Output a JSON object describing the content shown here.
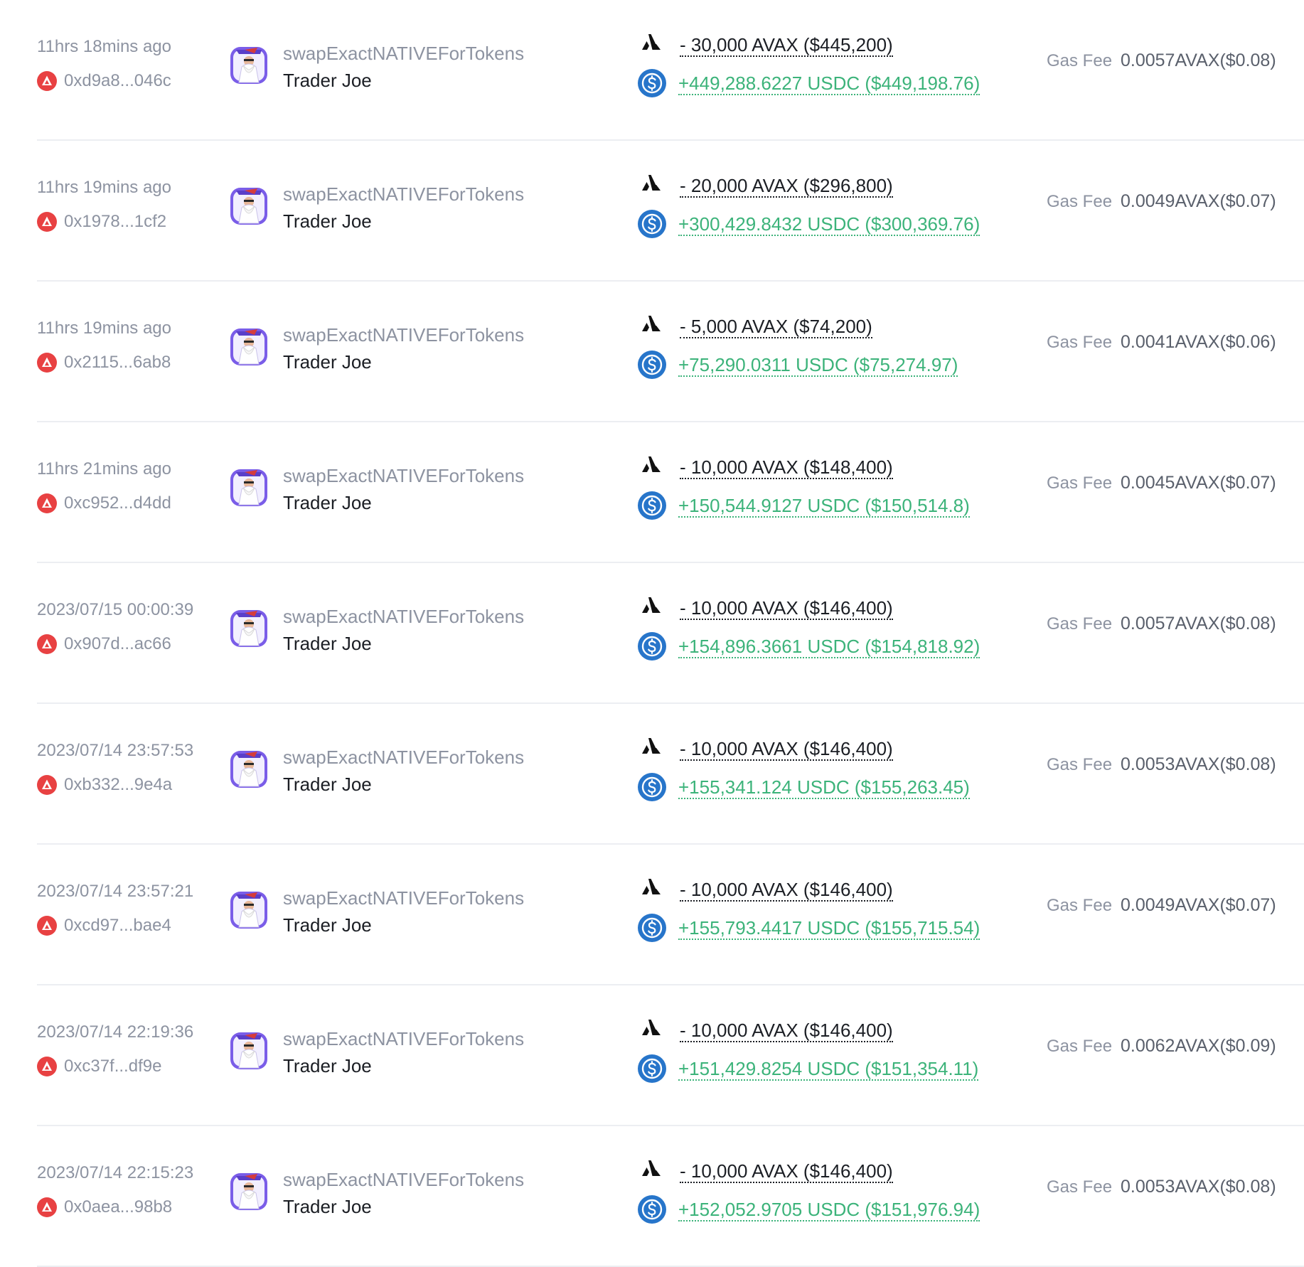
{
  "labels": {
    "gas_fee": "Gas Fee",
    "method": "swapExactNATIVEForTokens",
    "protocol": "Trader Joe"
  },
  "icons": {
    "chain": "avalanche-chain-badge",
    "protocol_avatar": "trader-joe-wizard-avatar",
    "token_out": "avax-logo",
    "token_in": "usdc-logo"
  },
  "colors": {
    "chain_badge": "#e84142",
    "positive": "#3cb37a",
    "usdc": "#2775ca",
    "muted": "#8d93a1",
    "text": "#1b1e24"
  },
  "transactions": [
    {
      "time": "11hrs 18mins ago",
      "hash": "0xd9a8...046c",
      "out": "- 30,000 AVAX ($445,200)",
      "in": "+449,288.6227 USDC ($449,198.76)",
      "gas": "0.0057AVAX($0.08)"
    },
    {
      "time": "11hrs 19mins ago",
      "hash": "0x1978...1cf2",
      "out": "- 20,000 AVAX ($296,800)",
      "in": "+300,429.8432 USDC ($300,369.76)",
      "gas": "0.0049AVAX($0.07)"
    },
    {
      "time": "11hrs 19mins ago",
      "hash": "0x2115...6ab8",
      "out": "- 5,000 AVAX ($74,200)",
      "in": "+75,290.0311 USDC ($75,274.97)",
      "gas": "0.0041AVAX($0.06)"
    },
    {
      "time": "11hrs 21mins ago",
      "hash": "0xc952...d4dd",
      "out": "- 10,000 AVAX ($148,400)",
      "in": "+150,544.9127 USDC ($150,514.8)",
      "gas": "0.0045AVAX($0.07)"
    },
    {
      "time": "2023/07/15 00:00:39",
      "hash": "0x907d...ac66",
      "out": "- 10,000 AVAX ($146,400)",
      "in": "+154,896.3661 USDC ($154,818.92)",
      "gas": "0.0057AVAX($0.08)"
    },
    {
      "time": "2023/07/14 23:57:53",
      "hash": "0xb332...9e4a",
      "out": "- 10,000 AVAX ($146,400)",
      "in": "+155,341.124 USDC ($155,263.45)",
      "gas": "0.0053AVAX($0.08)"
    },
    {
      "time": "2023/07/14 23:57:21",
      "hash": "0xcd97...bae4",
      "out": "- 10,000 AVAX ($146,400)",
      "in": "+155,793.4417 USDC ($155,715.54)",
      "gas": "0.0049AVAX($0.07)"
    },
    {
      "time": "2023/07/14 22:19:36",
      "hash": "0xc37f...df9e",
      "out": "- 10,000 AVAX ($146,400)",
      "in": "+151,429.8254 USDC ($151,354.11)",
      "gas": "0.0062AVAX($0.09)"
    },
    {
      "time": "2023/07/14 22:15:23",
      "hash": "0x0aea...98b8",
      "out": "- 10,000 AVAX ($146,400)",
      "in": "+152,052.9705 USDC ($151,976.94)",
      "gas": "0.0053AVAX($0.08)"
    }
  ]
}
